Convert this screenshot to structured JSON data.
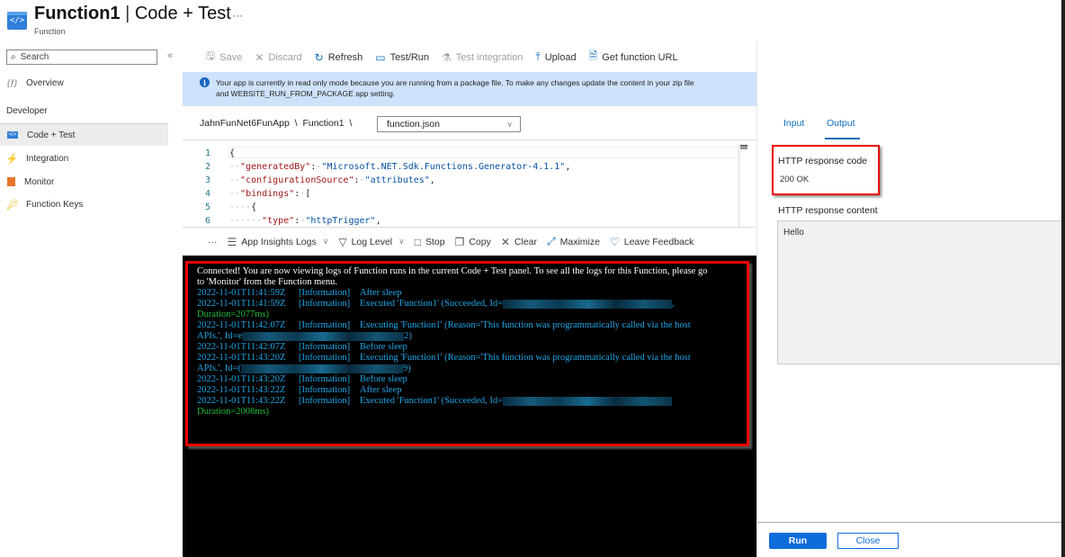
{
  "header": {
    "title_bold": "Function1",
    "title_sep": " | ",
    "title_rest": "Code + Test",
    "subtitle": "Function",
    "more": "···",
    "app_icon": "function-code-icon"
  },
  "sidebar": {
    "search_placeholder": "Search",
    "collapse": "«",
    "overview": {
      "label": "Overview",
      "icon": "fx-icon"
    },
    "section": "Developer",
    "items": [
      {
        "label": "Code + Test",
        "icon": "code-icon",
        "active": true
      },
      {
        "label": "Integration",
        "icon": "lightning-icon"
      },
      {
        "label": "Monitor",
        "icon": "monitor-icon"
      },
      {
        "label": "Function Keys",
        "icon": "key-icon"
      }
    ]
  },
  "toolbar": {
    "save": "Save",
    "discard": "Discard",
    "refresh": "Refresh",
    "test_run": "Test/Run",
    "test_integration": "Test integration",
    "upload": "Upload",
    "get_url": "Get function URL"
  },
  "banner": {
    "line1": "Your app is currently in read only mode because you are running from a package file. To make any changes update the content in your zip file",
    "line2": "and WEBSITE_RUN_FROM_PACKAGE app setting."
  },
  "breadcrumb": {
    "app": "JahnFunNet6FunApp",
    "sep": "\\",
    "function": "Function1",
    "file": "function.json"
  },
  "editor": {
    "lines": [
      {
        "n": "1"
      },
      {
        "n": "2",
        "key": "\"generatedBy\"",
        "value": "\"Microsoft.NET.Sdk.Functions.Generator-4.1.1\""
      },
      {
        "n": "3",
        "key": "\"configurationSource\"",
        "value": "\"attributes\""
      },
      {
        "n": "4",
        "key": "\"bindings\""
      },
      {
        "n": "5"
      },
      {
        "n": "6",
        "key": "\"type\"",
        "value": "\"httpTrigger\""
      }
    ]
  },
  "logbar": {
    "more": "···",
    "app_insights": "App Insights Logs",
    "log_level": "Log Level",
    "stop": "Stop",
    "copy": "Copy",
    "clear": "Clear",
    "maximize": "Maximize",
    "feedback": "Leave Feedback"
  },
  "logs": {
    "intro1": "Connected! You are now viewing logs of Function runs in the current Code + Test panel. To see all the logs for this Function, please go",
    "intro2": "to 'Monitor' from the Function menu.",
    "entries": [
      {
        "ts": "2022-11-01T11:41:59Z",
        "level": "[Information]",
        "msg": "After sleep"
      },
      {
        "ts": "2022-11-01T11:41:59Z",
        "level": "[Information]",
        "msg": "Executed 'Function1' (Succeeded, Id=",
        "tail": ",",
        "cont": "Duration=2077ms)"
      },
      {
        "ts": "2022-11-01T11:42:07Z",
        "level": "[Information]",
        "msg": "Executing 'Function1' (Reason='This function was programmatically called via the host",
        "cont_pre": "APIs.', Id=e",
        "cont_post": "2)"
      },
      {
        "ts": "2022-11-01T11:42:07Z",
        "level": "[Information]",
        "msg": "Before sleep"
      },
      {
        "ts": "2022-11-01T11:43:20Z",
        "level": "[Information]",
        "msg": "Executing 'Function1' (Reason='This function was programmatically called via the host",
        "cont_pre": "APIs.', Id=(",
        "cont_post": "9)"
      },
      {
        "ts": "2022-11-01T11:43:20Z",
        "level": "[Information]",
        "msg": "Before sleep"
      },
      {
        "ts": "2022-11-01T11:43:22Z",
        "level": "[Information]",
        "msg": "After sleep"
      },
      {
        "ts": "2022-11-01T11:43:22Z",
        "level": "[Information]",
        "msg": "Executed 'Function1' (Succeeded, Id=",
        "cont": "Duration=2008ms)"
      }
    ]
  },
  "right_panel": {
    "tabs": [
      {
        "label": "Input"
      },
      {
        "label": "Output",
        "active": true
      }
    ],
    "response_code_label": "HTTP response code",
    "response_code": "200 OK",
    "response_content_label": "HTTP response content",
    "response_content": "Hello",
    "run": "Run",
    "close": "Close"
  },
  "colors": {
    "accent": "#0f6cdb",
    "banner": "#cfe2fb",
    "highlight": "#ee0000",
    "log_info": "#1ea7e8",
    "log_success": "#1fbf3a"
  }
}
